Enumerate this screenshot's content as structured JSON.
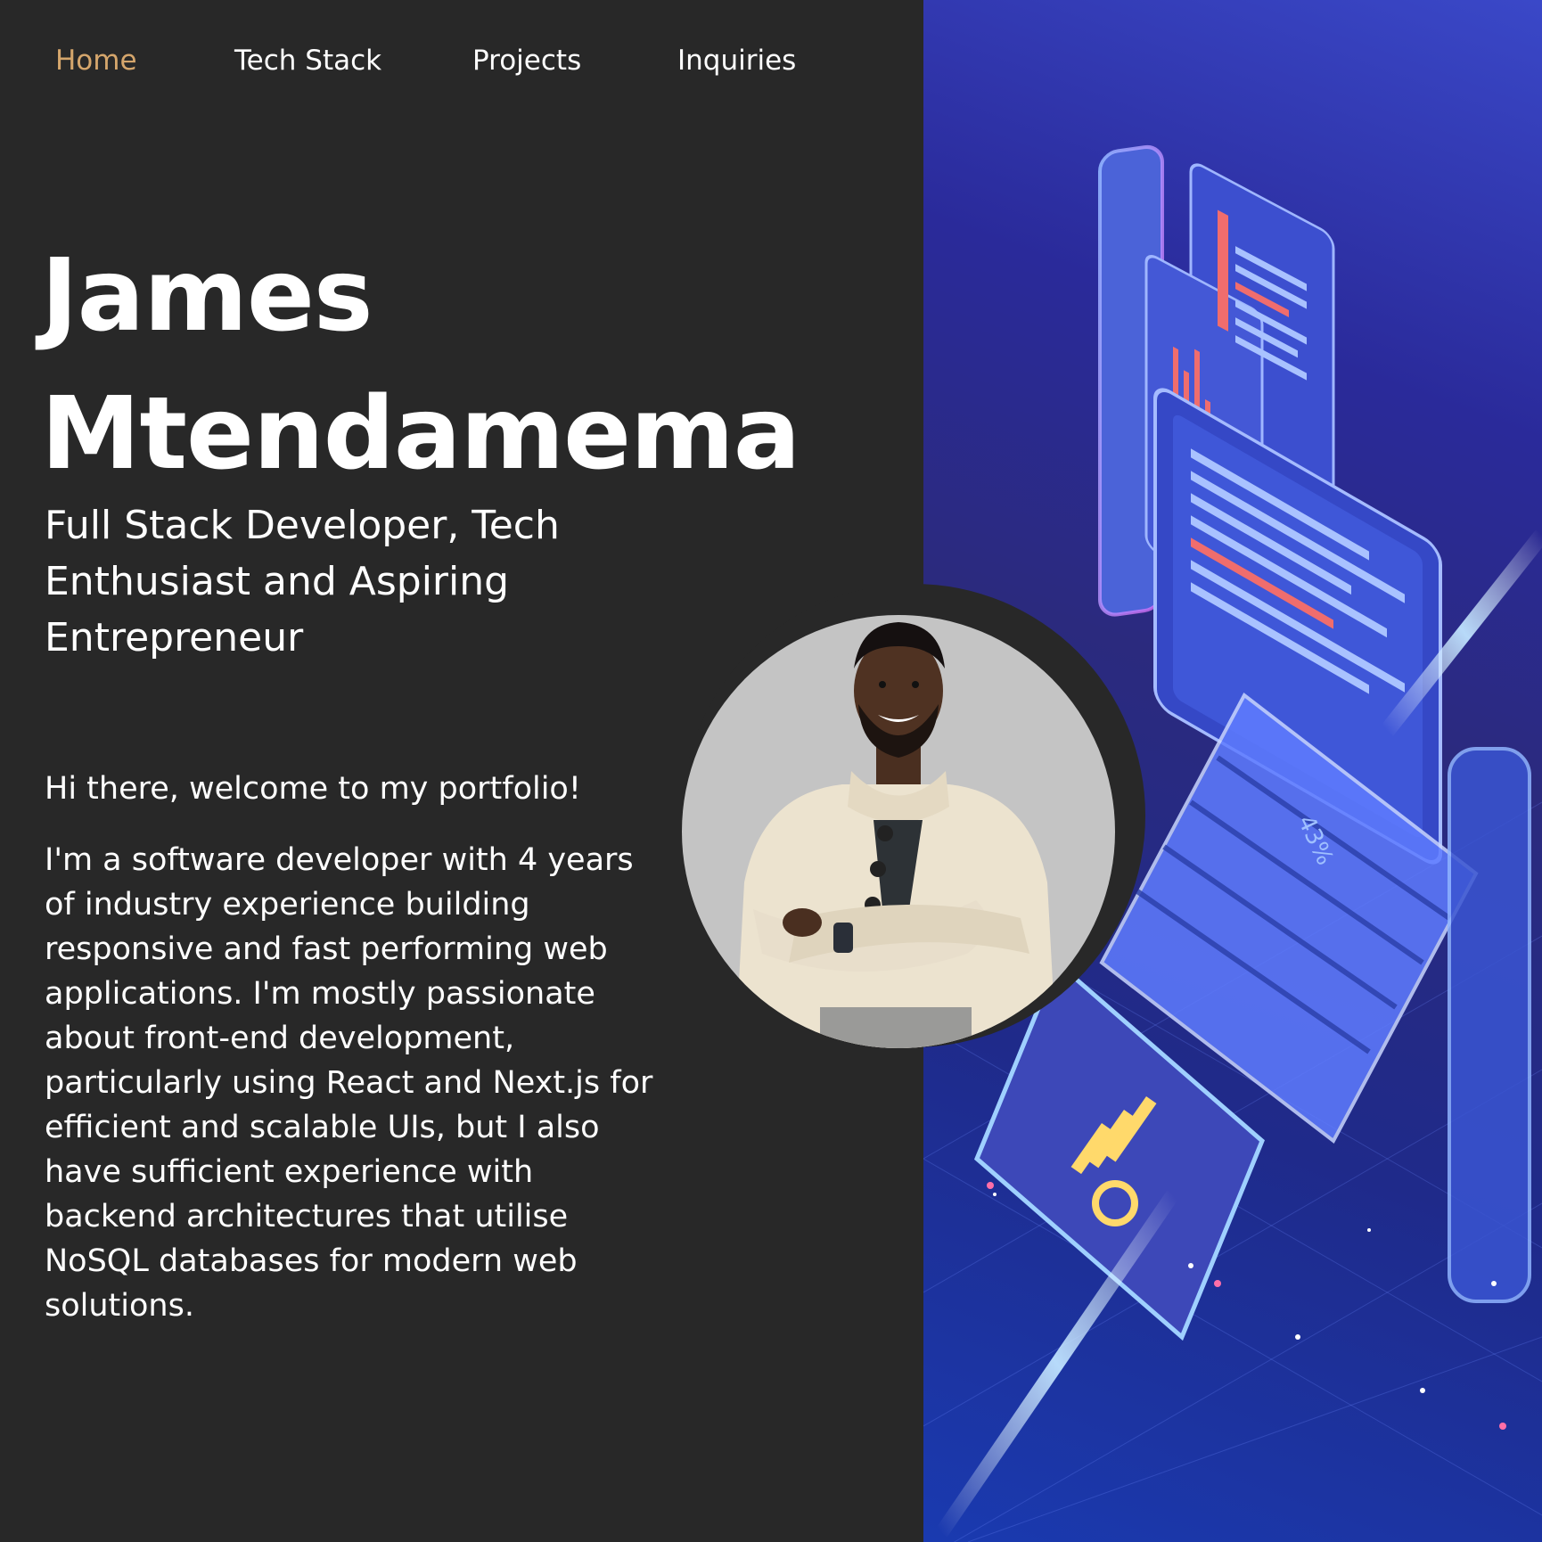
{
  "nav": {
    "items": [
      {
        "label": "Home",
        "active": true
      },
      {
        "label": "Tech Stack",
        "active": false
      },
      {
        "label": "Projects",
        "active": false
      },
      {
        "label": "Inquiries",
        "active": false
      }
    ],
    "active_color": "#d5a66c"
  },
  "hero": {
    "first_name": "James",
    "last_name": "Mtendamema",
    "subtitle": "Full Stack Developer, Tech Enthusiast and Aspiring Entrepreneur",
    "greeting": "Hi there, welcome to my portfolio!",
    "bio": "I'm a software developer with 4 years of industry experience building responsive and fast performing web applications. I'm mostly passionate about front-end development, particularly using React and Next.js for efficient and scalable UIs, but I also have sufficient experience with backend architectures that utilise NoSQL databases for modern web solutions."
  },
  "illustration": {
    "screen_percent_text": "43%"
  },
  "colors": {
    "background": "#282828",
    "text": "#ffffff",
    "accent": "#d5a66c"
  }
}
